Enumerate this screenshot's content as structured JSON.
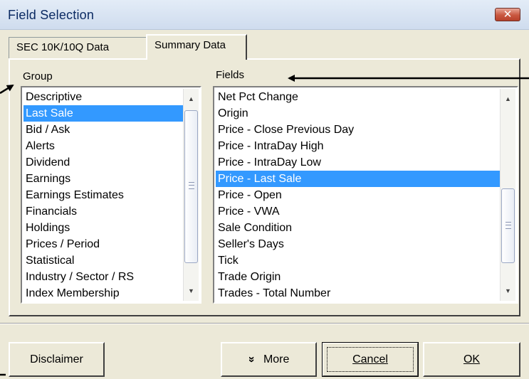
{
  "window": {
    "title": "Field Selection",
    "close_glyph": "✕"
  },
  "tabs": [
    {
      "label": "SEC 10K/10Q Data",
      "active": false
    },
    {
      "label": "Summary Data",
      "active": true
    }
  ],
  "group": {
    "label": "Group",
    "items": [
      "Descriptive",
      "Last Sale",
      "Bid / Ask",
      "Alerts",
      "Dividend",
      "Earnings",
      "Earnings Estimates",
      "Financials",
      "Holdings",
      "Prices / Period",
      "Statistical",
      "Industry / Sector / RS",
      "Index Membership"
    ],
    "selected": "Last Sale"
  },
  "fields": {
    "label": "Fields",
    "items": [
      "Net Pct Change",
      "Origin",
      "Price - Close Previous Day",
      "Price - IntraDay High",
      "Price - IntraDay Low",
      "Price - Last Sale",
      "Price - Open",
      "Price - VWA",
      "Sale Condition",
      "Seller's Days",
      "Tick",
      "Trade Origin",
      "Trades - Total Number"
    ],
    "selected": "Price - Last Sale"
  },
  "buttons": {
    "disclaimer": "Disclaimer",
    "more": "More",
    "more_icon": "»",
    "cancel": "Cancel",
    "ok": "OK"
  },
  "icons": {
    "close": "close-icon",
    "more": "double-chevron-down-icon",
    "scroll_up": "triangle-up-icon",
    "scroll_down": "triangle-down-icon",
    "annotation": "arrow-icon"
  },
  "colors": {
    "selection": "#3399ff",
    "dialog_bg": "#ece9d8",
    "title_text": "#0b2a63",
    "close_button": "#c9573f"
  }
}
